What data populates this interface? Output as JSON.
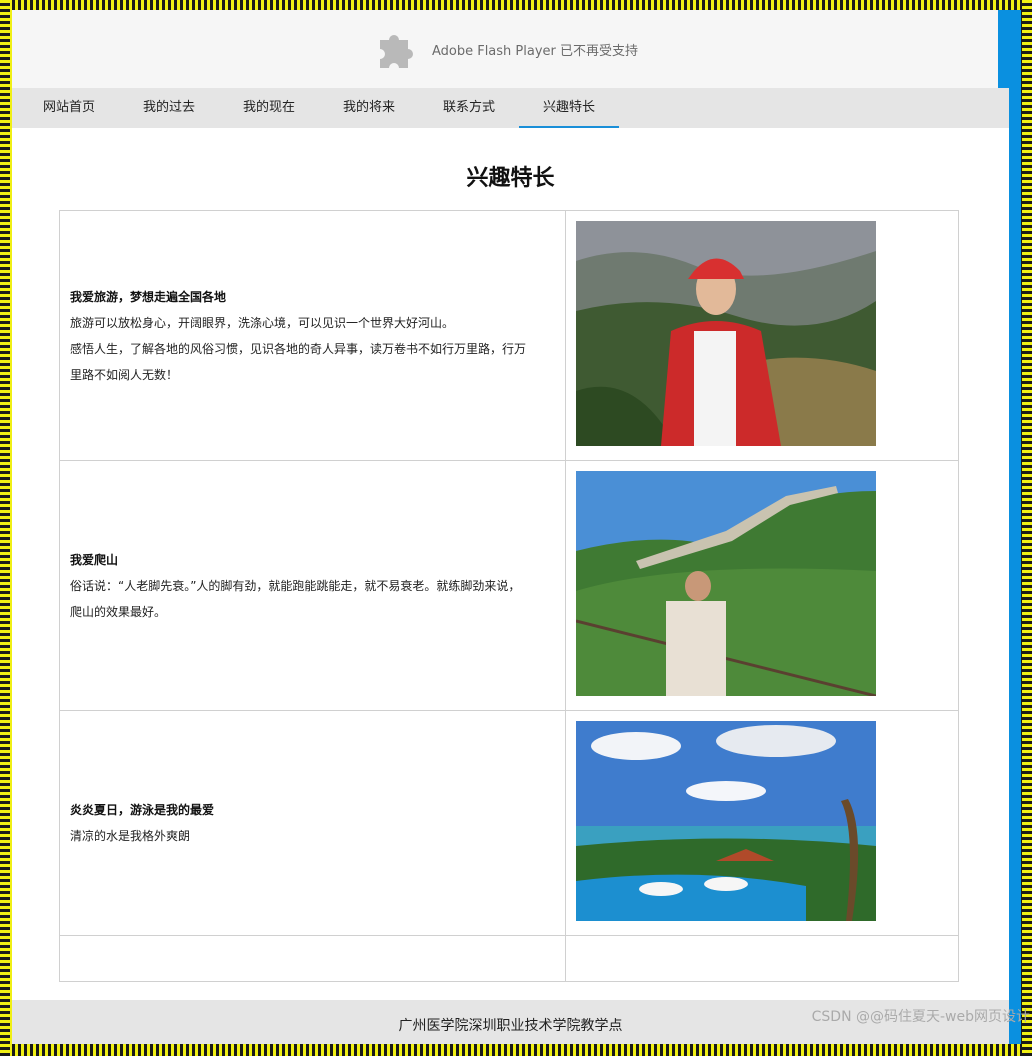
{
  "banner": {
    "text": "Adobe Flash Player 已不再受支持"
  },
  "nav": {
    "items": [
      {
        "label": "网站首页"
      },
      {
        "label": "我的过去"
      },
      {
        "label": "我的现在"
      },
      {
        "label": "我的将来"
      },
      {
        "label": "联系方式"
      },
      {
        "label": "兴趣特长",
        "active": true
      }
    ]
  },
  "page": {
    "title": "兴趣特长"
  },
  "hobbies": [
    {
      "title": "我爱旅游，梦想走遍全国各地",
      "lines": [
        "旅游可以放松身心，开阔眼界，洗涤心境，可以见识一个世界大好河山。",
        "感悟人生，了解各地的风俗习惯，见识各地的奇人异事，读万卷书不如行万里路，行万",
        "里路不如阅人无数！"
      ],
      "photo": "mountain-photo"
    },
    {
      "title": "我爱爬山",
      "lines": [
        "俗话说：“人老脚先衰。”人的脚有劲，就能跑能跳能走，就不易衰老。就练脚劲来说，",
        "爬山的效果最好。"
      ],
      "photo": "great-wall-photo"
    },
    {
      "title": "炎炎夏日，游泳是我的最爱",
      "lines": [
        "清凉的水是我格外爽朗"
      ],
      "photo": "resort-pool-photo"
    }
  ],
  "footer": {
    "text": "广州医学院深圳职业技术学院教学点"
  },
  "watermark": {
    "text": "CSDN @@码住夏天-web网页设计"
  },
  "colors": {
    "accent": "#1a8fd8",
    "side_bar": "#0a90e0"
  }
}
